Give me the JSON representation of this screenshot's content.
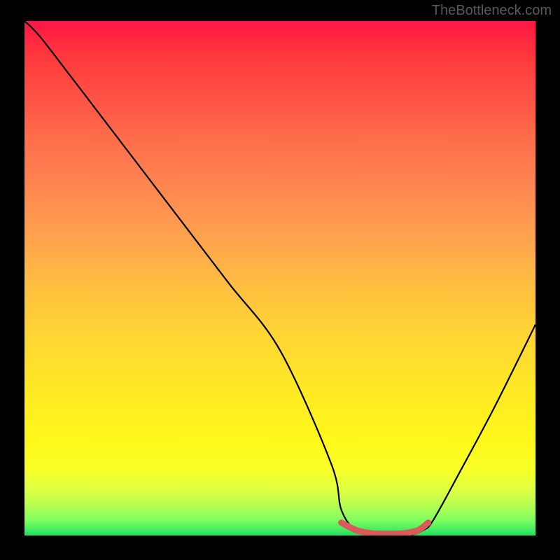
{
  "watermark": "TheBottleneck.com",
  "chart_data": {
    "type": "line",
    "title": "",
    "xlabel": "",
    "ylabel": "",
    "xlim": [
      0,
      100
    ],
    "ylim": [
      0,
      100
    ],
    "series": [
      {
        "name": "bottleneck-curve",
        "x": [
          0,
          3,
          10,
          20,
          30,
          40,
          50,
          60,
          62,
          65,
          70,
          75,
          78,
          80,
          85,
          92,
          100
        ],
        "y": [
          100,
          97,
          88,
          75,
          62,
          49,
          36,
          14,
          5,
          1,
          0,
          0,
          1,
          3,
          12,
          25,
          41
        ]
      },
      {
        "name": "optimal-marker",
        "x": [
          62,
          65,
          68,
          71,
          74,
          77,
          79
        ],
        "y": [
          2.5,
          1.0,
          0.4,
          0.3,
          0.4,
          1.0,
          2.5
        ]
      }
    ],
    "gradient_stops": [
      {
        "pos": 0,
        "color": "#ff1744"
      },
      {
        "pos": 50,
        "color": "#ffc040"
      },
      {
        "pos": 85,
        "color": "#fff81a"
      },
      {
        "pos": 100,
        "color": "#20e060"
      }
    ]
  }
}
